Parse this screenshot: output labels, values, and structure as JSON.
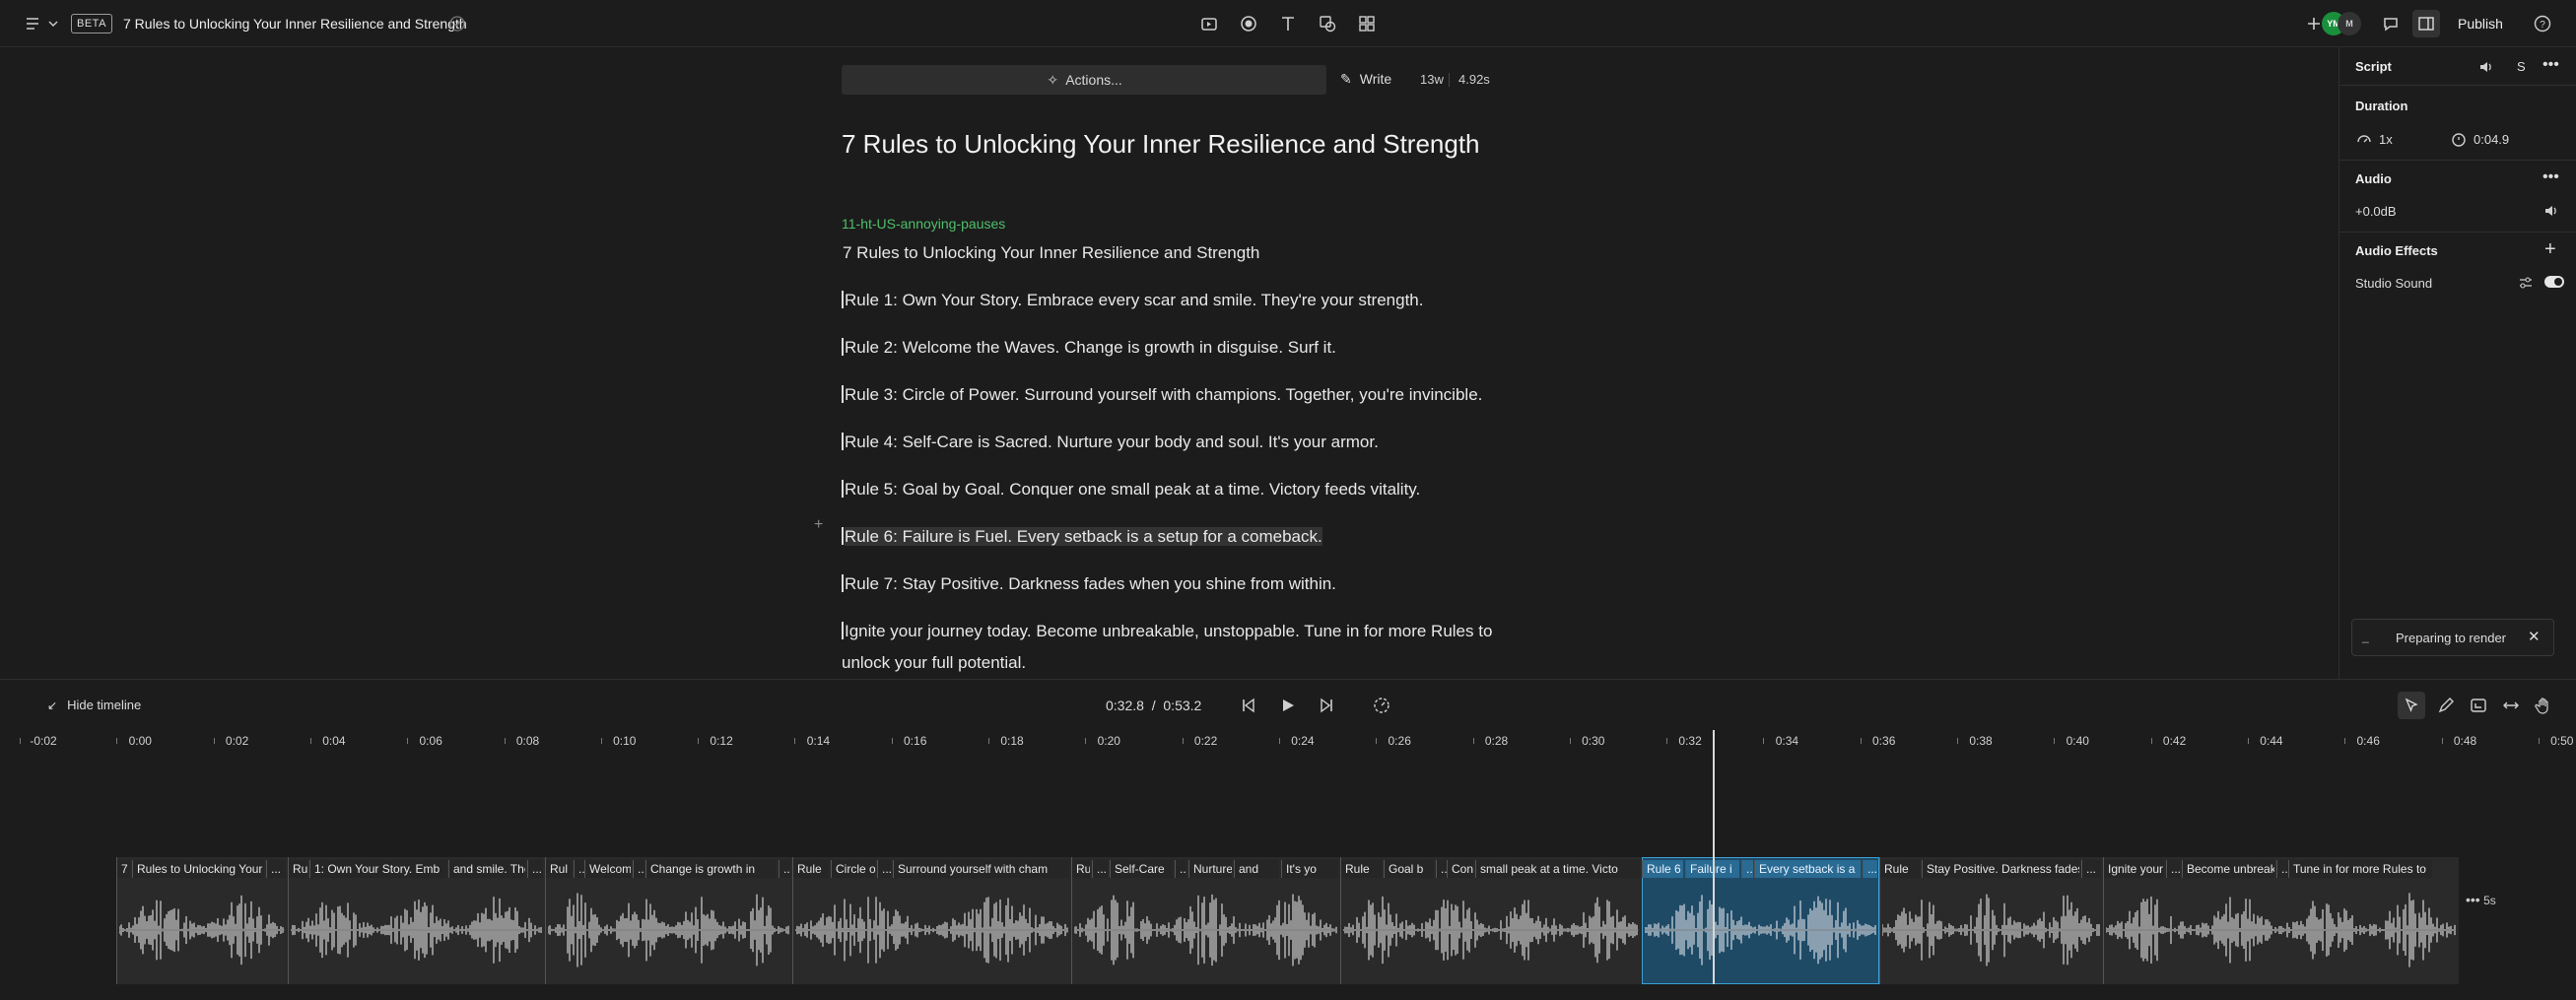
{
  "topbar": {
    "beta": "BETA",
    "title": "7 Rules to Unlocking Your Inner Resilience and Strength",
    "avatar1": "YM",
    "avatar2": "M",
    "publish": "Publish"
  },
  "editor": {
    "actions": "Actions...",
    "write": "Write",
    "words": "13w",
    "duration": "4.92s",
    "heading": "7 Rules to Unlocking Your Inner Resilience and Strength",
    "speaker": "11-ht-US-annoying-pauses",
    "paragraphs": [
      "7 Rules to Unlocking Your Inner Resilience and Strength",
      "Rule 1: Own Your Story. Embrace every scar and smile. They're your strength.",
      "Rule 2: Welcome the Waves. Change is growth in disguise. Surf it.",
      "Rule 3: Circle of Power. Surround yourself with champions. Together, you're invincible.",
      "Rule 4: Self-Care is Sacred. Nurture your body and soul. It's your armor.",
      "Rule 5: Goal by Goal. Conquer one small peak at a time. Victory feeds vitality.",
      "Rule 6: Failure is Fuel. Every setback is a setup for a comeback.",
      "Rule 7: Stay Positive. Darkness fades when you shine from within.",
      "Ignite your journey today. Become unbreakable, unstoppable. Tune in for more Rules to",
      "unlock your full potential."
    ]
  },
  "panel": {
    "script": "Script",
    "s_label": "S",
    "duration_title": "Duration",
    "speed": "1x",
    "length": "0:04.9",
    "audio_title": "Audio",
    "gain": "+0.0dB",
    "effects_title": "Audio Effects",
    "studio_sound": "Studio Sound",
    "studio_sound_on": true,
    "toast": "Preparing to render"
  },
  "timeline": {
    "hide": "Hide timeline",
    "current": "0:32.8",
    "sep": "/",
    "total": "0:53.2",
    "ruler": [
      "-0:02",
      "0:00",
      "0:02",
      "0:04",
      "0:06",
      "0:08",
      "0:10",
      "0:12",
      "0:14",
      "0:16",
      "0:18",
      "0:20",
      "0:22",
      "0:24",
      "0:26",
      "0:28",
      "0:30",
      "0:32",
      "0:34",
      "0:36",
      "0:38",
      "0:40",
      "0:42",
      "0:44",
      "0:46",
      "0:48",
      "0:50"
    ],
    "five_s": "5s",
    "words": [
      "7",
      "Rules to Unlocking Your",
      "...",
      "Ru",
      "1: Own Your Story. Emb",
      "and smile. The",
      "...",
      "Rul",
      "...",
      "Welcom",
      "...",
      "Change is growth in",
      "...",
      "Rule",
      "Circle o",
      "...",
      "Surround yourself with cham",
      "Rule",
      "...",
      "Self-Care",
      "...",
      "Nurture",
      "and",
      "It's yo",
      "Rule",
      "Goal b",
      "...",
      "Conq",
      "small peak at a time. Victo",
      "Rule 6",
      "Failure i",
      "...",
      "Every setback is a",
      "...",
      "Rule",
      "Stay Positive. Darkness fades",
      "...",
      "Ignite your",
      "...",
      "Become unbreak",
      "...",
      "Tune in for more Rules to"
    ]
  }
}
